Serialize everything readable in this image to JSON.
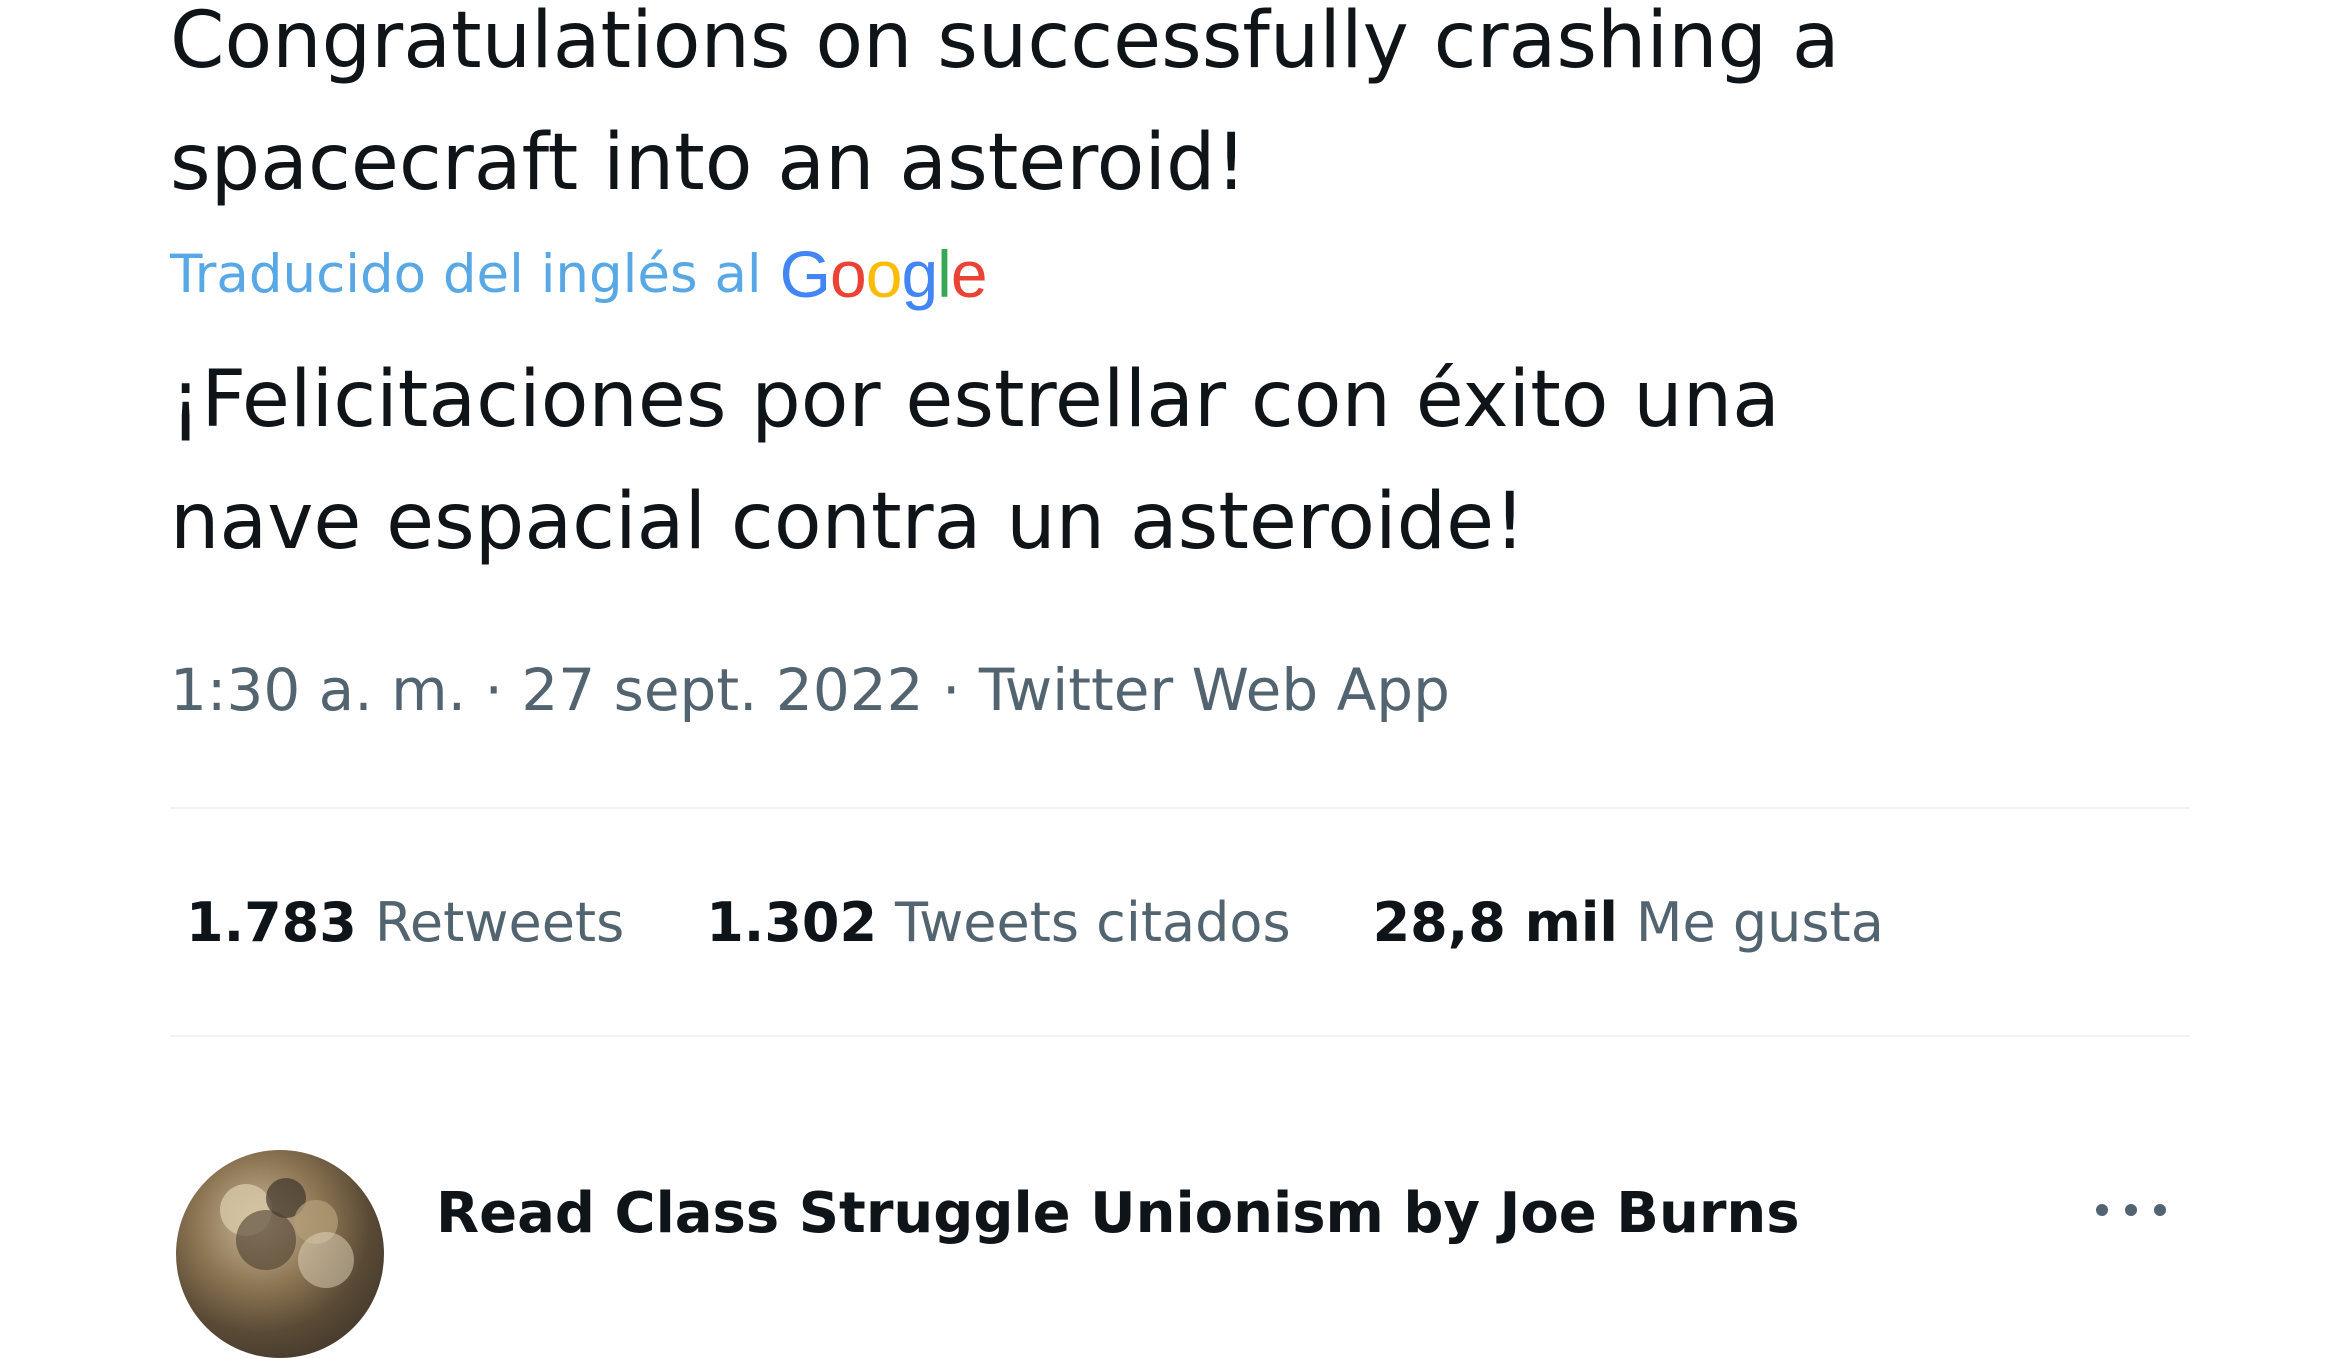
{
  "tweet": {
    "original_text": "Congratulations on successfully crashing a spacecraft into an asteroid!",
    "translation_label": "Traducido del inglés al",
    "translation_provider": {
      "letters": [
        "G",
        "o",
        "o",
        "g",
        "l",
        "e"
      ],
      "colors": [
        "#4285f4",
        "#ea4335",
        "#fbbc05",
        "#4285f4",
        "#34a853",
        "#ea4335"
      ]
    },
    "translated_text": "¡Felicitaciones por estrellar con éxito una nave espacial contra un asteroide!",
    "meta": {
      "time": "1:30 a. m.",
      "date": "27 sept. 2022",
      "source": "Twitter Web App",
      "separator": "·"
    },
    "stats": [
      {
        "count": "1.783",
        "label": "Retweets"
      },
      {
        "count": "1.302",
        "label": "Tweets citados"
      },
      {
        "count": "28,8 mil",
        "label": "Me gusta"
      }
    ]
  },
  "reply": {
    "author_name": "Read Class Struggle Unionism by Joe Burns",
    "avatar_icon": "avatar",
    "more_icon": "more-options-icon"
  },
  "colors": {
    "text": "#0f1419",
    "secondary": "#536471",
    "translation_link": "#58a8e6",
    "divider": "#eff3f4"
  }
}
